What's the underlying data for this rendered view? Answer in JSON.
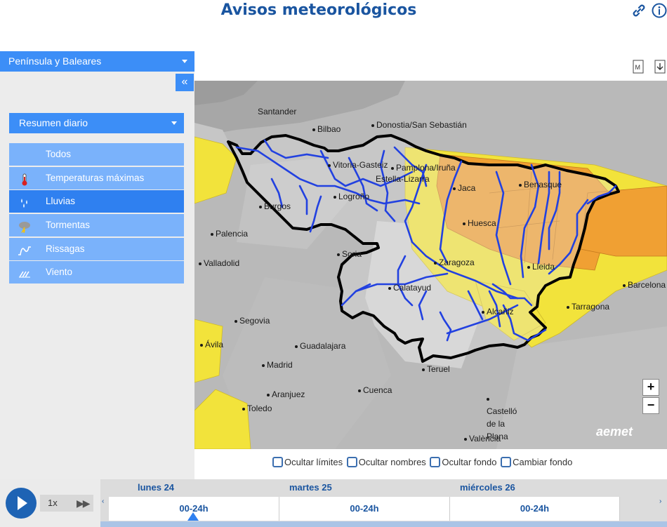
{
  "title": "Avisos meteorológicos",
  "header": {
    "link_icon": "link-icon",
    "info_icon": "info-icon"
  },
  "sidebar": {
    "region": "Península y Baleares",
    "collapse_label": "«",
    "summary": "Resumen diario",
    "items": [
      {
        "label": "Todos",
        "icon": ""
      },
      {
        "label": "Temperaturas máximas",
        "icon": "thermometer-icon"
      },
      {
        "label": "Lluvias",
        "icon": "rain-icon"
      },
      {
        "label": "Tormentas",
        "icon": "storm-icon"
      },
      {
        "label": "Rissagas",
        "icon": "wave-icon"
      },
      {
        "label": "Viento",
        "icon": "wind-icon"
      }
    ],
    "active_item": "Lluvias"
  },
  "map": {
    "places": [
      "Santander",
      "Bilbao",
      "Donostia/San Sebastián",
      "Vitoria-Gasteiz",
      "Pamplona/Iruña",
      "Estella-Lizarra",
      "Logroño",
      "Burgos",
      "Jaca",
      "Benasque",
      "Huesca",
      "Palencia",
      "Soria",
      "Zaragoza",
      "Lleida",
      "Barcelona",
      "Valladolid",
      "Calatayud",
      "Alcañiz",
      "Tarragona",
      "Segovia",
      "Ávila",
      "Guadalajara",
      "Madrid",
      "Teruel",
      "Cuenca",
      "Aranjuez",
      "Toledo",
      "Castelló de la Plana",
      "València"
    ],
    "colors": {
      "yellow": "#f2e33b",
      "orange": "#f0a033",
      "border": "#000000",
      "rivers": "#2241e0"
    },
    "zoom_in": "+",
    "zoom_out": "−",
    "brand": "aemet"
  },
  "options": [
    "Ocultar límites",
    "Ocultar nombres",
    "Ocultar fondo",
    "Cambiar fondo"
  ],
  "timeline": {
    "speed": "1x",
    "days": [
      {
        "day": "lunes 24",
        "slot": "00-24h"
      },
      {
        "day": "martes 25",
        "slot": "00-24h"
      },
      {
        "day": "miércoles 26",
        "slot": "00-24h"
      }
    ]
  }
}
